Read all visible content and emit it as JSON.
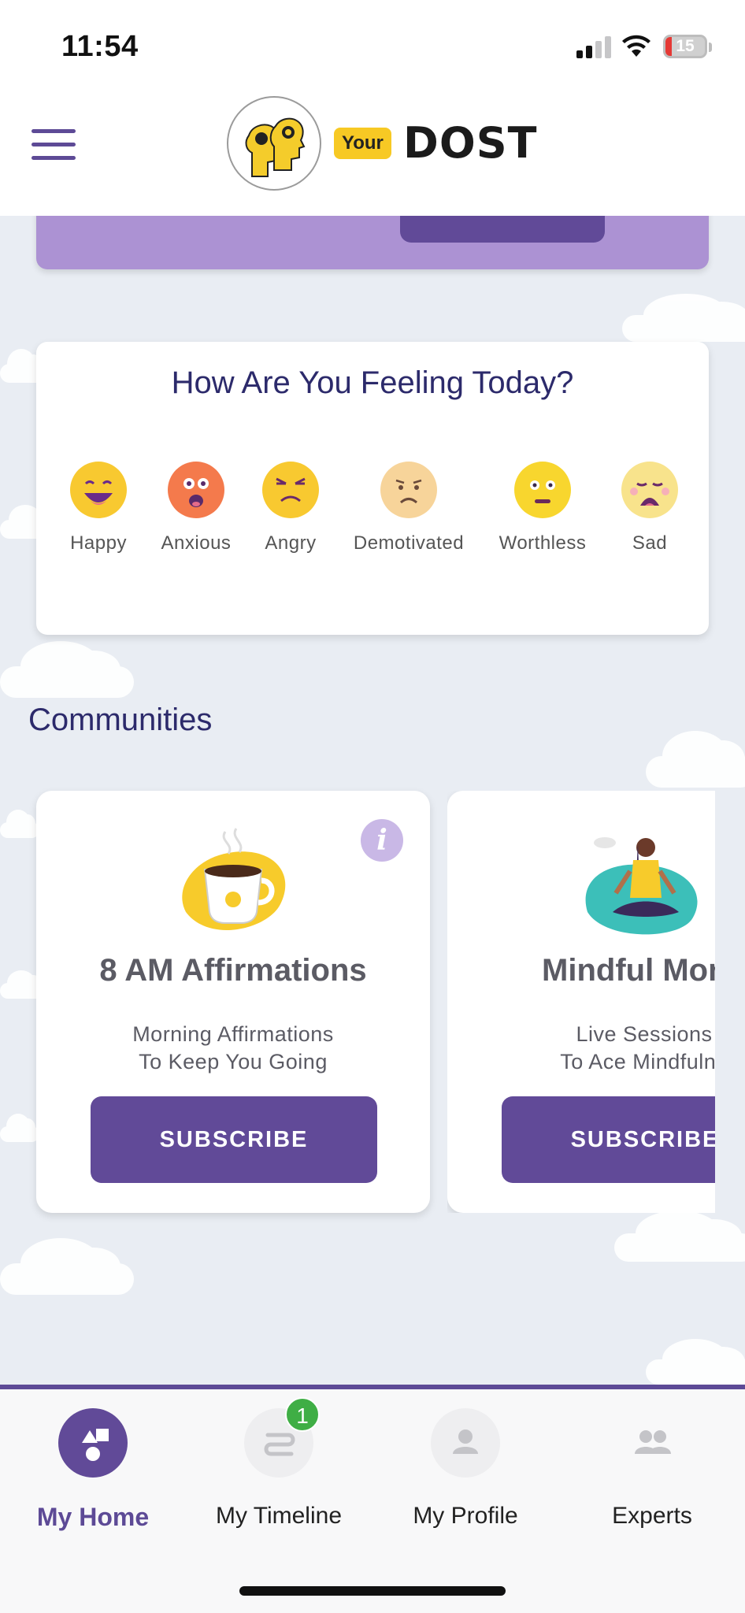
{
  "status_bar": {
    "time": "11:54",
    "battery": "15",
    "battery_color": "#e53935"
  },
  "header": {
    "menu_icon": "hamburger-menu-icon",
    "logo_your": "Your",
    "logo_dost": "DOST",
    "logo_icon": "two-heads-logo-icon"
  },
  "feelings": {
    "title": "How Are You Feeling Today?",
    "moods": [
      {
        "label": "Happy",
        "icon": "happy-face-icon",
        "color": "#f8c930"
      },
      {
        "label": "Anxious",
        "icon": "anxious-face-icon",
        "color": "#f47a4c"
      },
      {
        "label": "Angry",
        "icon": "angry-face-icon",
        "color": "#f8c930"
      },
      {
        "label": "Demotivated",
        "icon": "demotivated-face-icon",
        "color": "#f7d49a"
      },
      {
        "label": "Worthless",
        "icon": "worthless-face-icon",
        "color": "#f8d62e"
      },
      {
        "label": "Sad",
        "icon": "sad-face-icon",
        "color": "#f8e38c"
      }
    ]
  },
  "communities": {
    "title": "Communities",
    "cards": [
      {
        "title": "8 AM Affirmations",
        "desc_line1": "Morning Affirmations",
        "desc_line2": "To Keep You Going",
        "button": "SUBSCRIBE",
        "icon": "coffee-cup-icon",
        "info": "i"
      },
      {
        "title": "Mindful Mond",
        "desc_line1": "Live Sessions",
        "desc_line2": "To Ace Mindfulne",
        "button": "SUBSCRIBE",
        "icon": "meditation-woman-icon"
      }
    ]
  },
  "bottom_nav": {
    "items": [
      {
        "label": "My Home",
        "icon": "home-shapes-icon",
        "active": true
      },
      {
        "label": "My Timeline",
        "icon": "timeline-icon",
        "badge": "1"
      },
      {
        "label": "My Profile",
        "icon": "profile-icon"
      },
      {
        "label": "Experts",
        "icon": "experts-icon"
      }
    ]
  },
  "colors": {
    "brand_purple": "#614a98",
    "banner_purple": "#ac92d3",
    "title_navy": "#2c2a6b",
    "badge_green": "#3fae45"
  }
}
